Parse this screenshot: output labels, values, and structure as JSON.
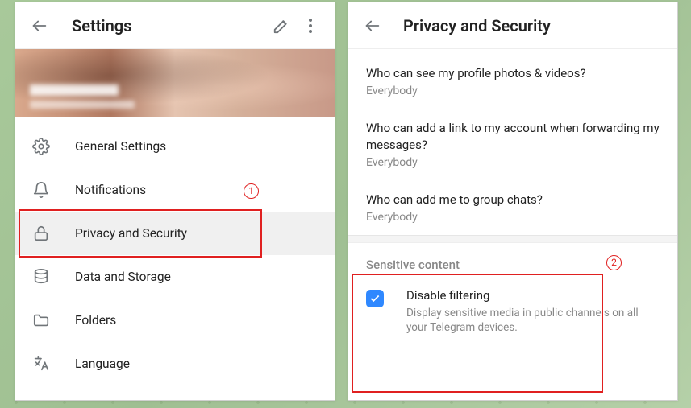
{
  "left": {
    "title": "Settings",
    "menu": [
      {
        "key": "general",
        "label": "General Settings"
      },
      {
        "key": "notif",
        "label": "Notifications"
      },
      {
        "key": "privacy",
        "label": "Privacy and Security"
      },
      {
        "key": "data",
        "label": "Data and Storage"
      },
      {
        "key": "folders",
        "label": "Folders"
      },
      {
        "key": "lang",
        "label": "Language"
      }
    ]
  },
  "right": {
    "title": "Privacy and Security",
    "items": [
      {
        "title": "Who can see my profile photos & videos?",
        "value": "Everybody"
      },
      {
        "title": "Who can add a link to my account when forwarding my messages?",
        "value": "Everybody"
      },
      {
        "title": "Who can add me to group chats?",
        "value": "Everybody"
      }
    ],
    "section_header": "Sensitive content",
    "filter": {
      "title": "Disable filtering",
      "desc": "Display sensitive media in public channels on all your Telegram devices.",
      "checked": true
    }
  },
  "annotations": {
    "one": "1",
    "two": "2"
  }
}
